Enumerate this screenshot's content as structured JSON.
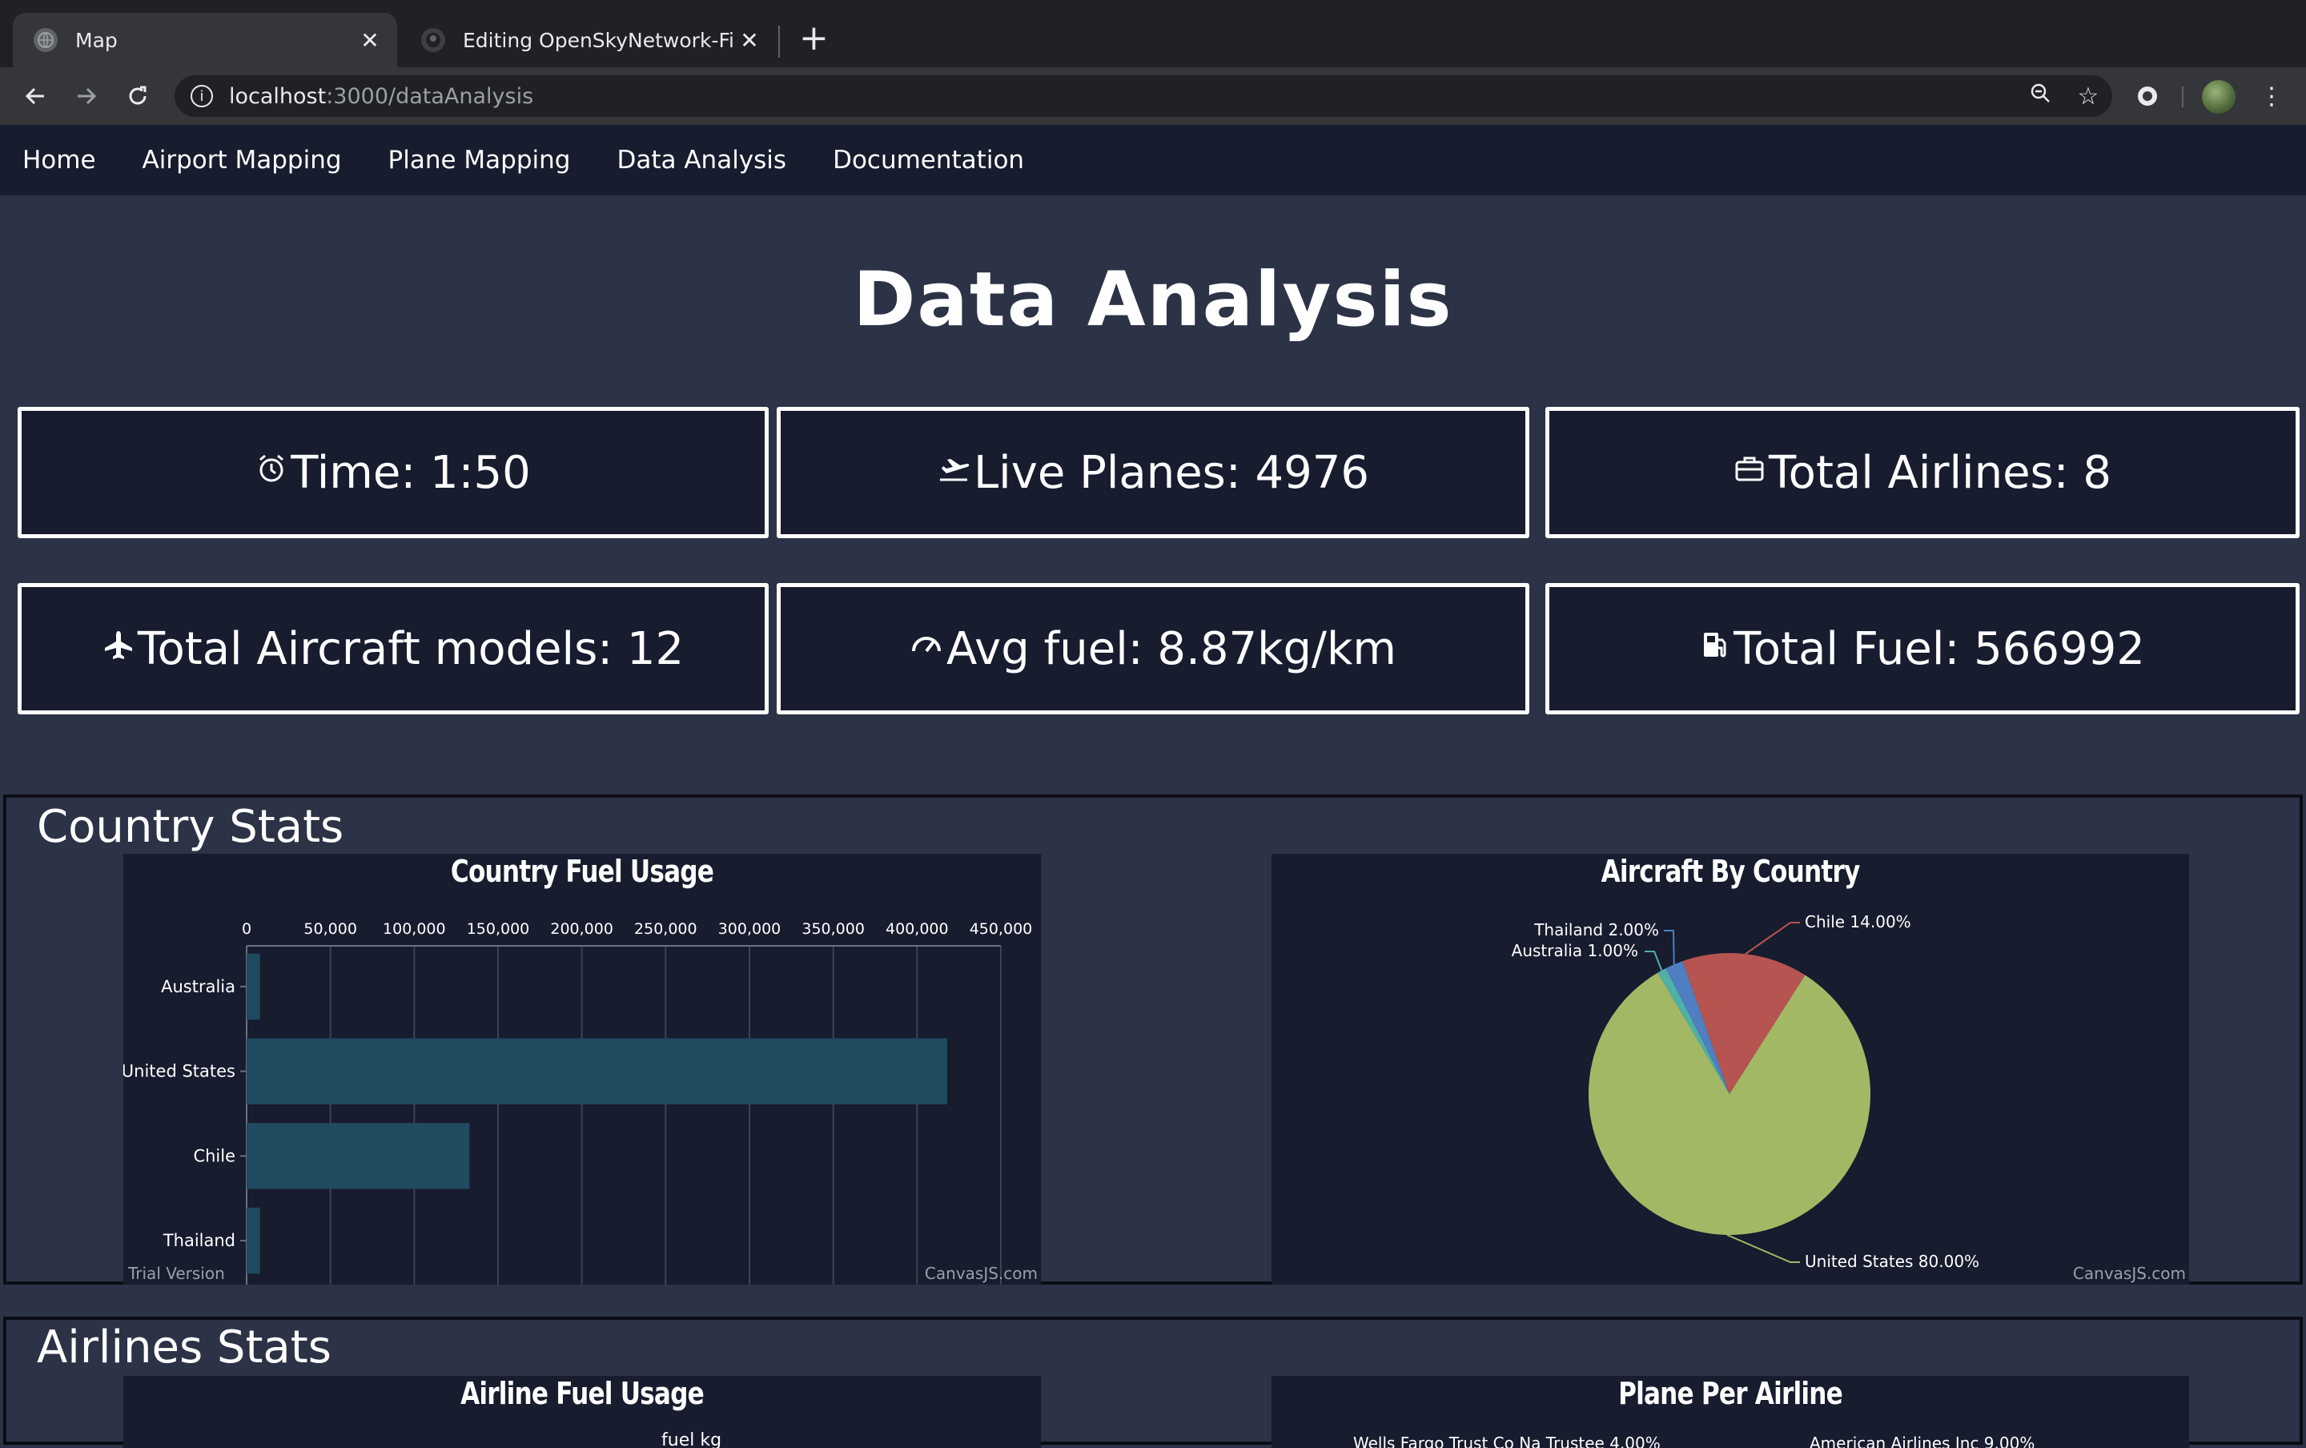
{
  "browser": {
    "tabs": [
      {
        "title": "Map",
        "active": true,
        "icon": "globe-icon"
      },
      {
        "title": "Editing OpenSkyNetwork-Final",
        "active": false,
        "icon": "github-icon"
      }
    ],
    "url_host": "localhost",
    "url_path": ":3000/dataAnalysis"
  },
  "nav": {
    "items": [
      "Home",
      "Airport Mapping",
      "Plane Mapping",
      "Data Analysis",
      "Documentation"
    ]
  },
  "page": {
    "title": "Data Analysis"
  },
  "stats": {
    "time": "Time: 1:50",
    "live_planes": "Live Planes: 4976",
    "total_airlines": "Total Airlines: 8",
    "total_models": "Total Aircraft models: 12",
    "avg_fuel": "Avg fuel: 8.87kg/km",
    "total_fuel": "Total Fuel: 566992"
  },
  "sections": {
    "country": "Country Stats",
    "airlines": "Airlines Stats"
  },
  "credits": {
    "trial": "Trial Version",
    "canvasjs": "CanvasJS.com"
  },
  "chart_data": [
    {
      "type": "bar",
      "orientation": "horizontal",
      "title": "Country Fuel Usage",
      "categories": [
        "Australia",
        "United States",
        "Chile",
        "Thailand"
      ],
      "values": [
        8000,
        418000,
        133000,
        8000
      ],
      "xlim": [
        0,
        450000
      ],
      "ticks": [
        "0",
        "50,000",
        "100,000",
        "150,000",
        "200,000",
        "250,000",
        "300,000",
        "350,000",
        "400,000",
        "450,000"
      ],
      "grid": true,
      "color": "#1f4a60"
    },
    {
      "type": "pie",
      "title": "Aircraft By Country",
      "slices": [
        {
          "label": "United States 80.00%",
          "value": 80,
          "color": "#a3b865"
        },
        {
          "label": "Chile 14.00%",
          "value": 14,
          "color": "#b55450"
        },
        {
          "label": "Thailand 2.00%",
          "value": 2,
          "color": "#4f7ec1"
        },
        {
          "label": "Australia 1.00%",
          "value": 1,
          "color": "#4fb1a5"
        }
      ]
    },
    {
      "type": "bar",
      "title": "Airline Fuel Usage",
      "ylabel": "fuel kg"
    },
    {
      "type": "pie",
      "title": "Plane Per Airline",
      "slices": [
        {
          "label": "Wells Fargo Trust Co Na Trustee 4.00%"
        },
        {
          "label": "American Airlines Inc 9.00%"
        }
      ]
    }
  ]
}
